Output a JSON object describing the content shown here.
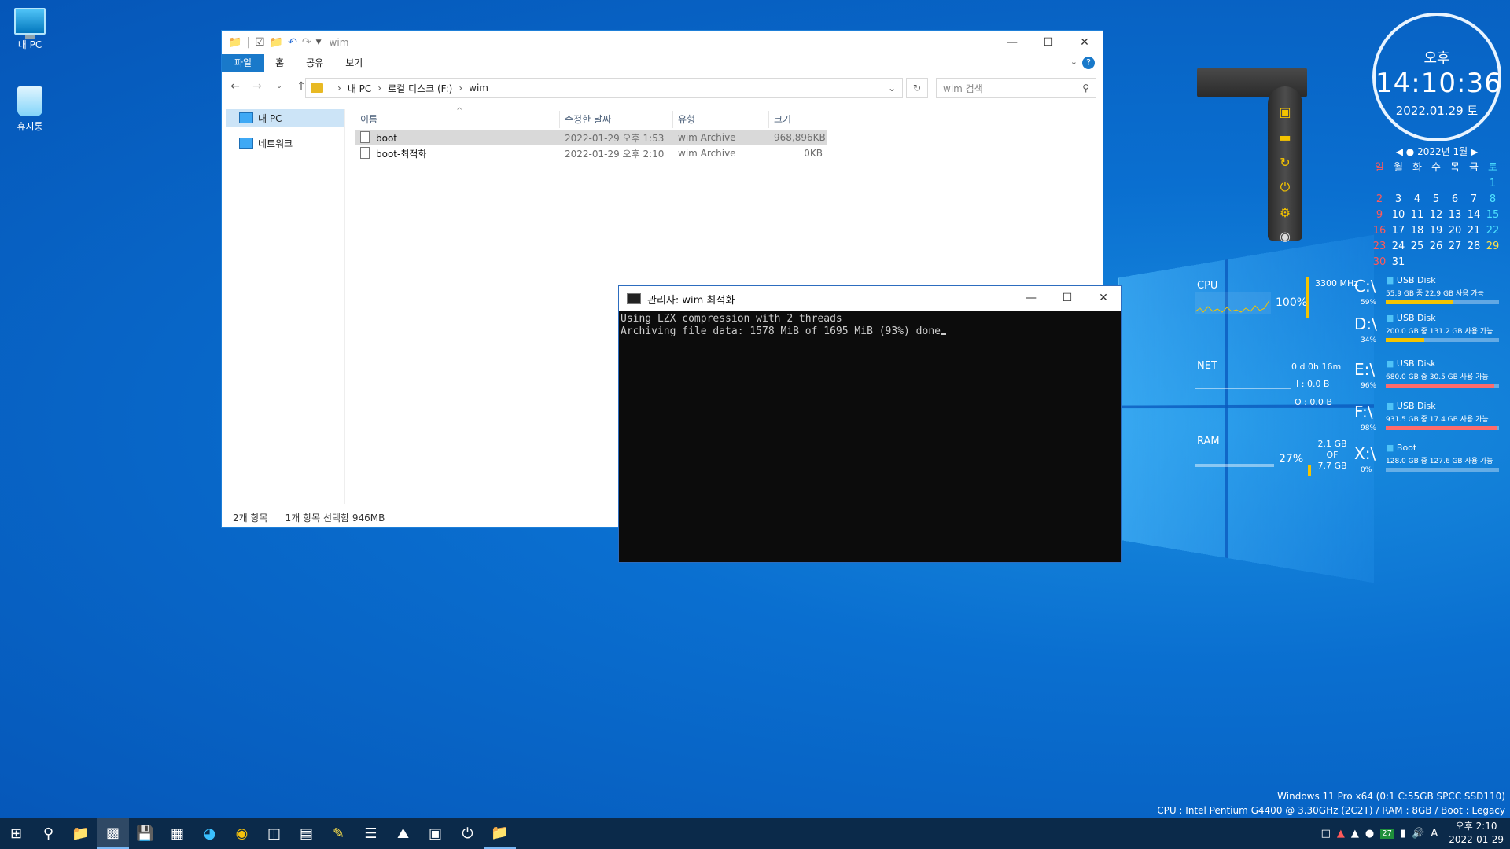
{
  "desktop": {
    "icons": [
      {
        "label": "내 PC"
      },
      {
        "label": "휴지통"
      }
    ]
  },
  "explorer": {
    "title": "wim",
    "ribbon_tabs": [
      "파일",
      "홈",
      "공유",
      "보기"
    ],
    "breadcrumb": [
      "내 PC",
      "로컬 디스크 (F:)",
      "wim"
    ],
    "search_placeholder": "wim 검색",
    "nav_items": [
      "내 PC",
      "네트워크"
    ],
    "columns": [
      "이름",
      "수정한 날짜",
      "유형",
      "크기"
    ],
    "files": [
      {
        "name": "boot",
        "modified": "2022-01-29 오후 1:53",
        "type": "wim Archive",
        "size": "968,896KB"
      },
      {
        "name": "boot-최적화",
        "modified": "2022-01-29 오후 2:10",
        "type": "wim Archive",
        "size": "0KB"
      }
    ],
    "status_count": "2개 항목",
    "status_selected": "1개 항목 선택함 946MB"
  },
  "console": {
    "title": "관리자:  wim 최적화",
    "lines": [
      "Using LZX compression with 2 threads",
      "Archiving file data: 1578 MiB of 1695 MiB (93%) done"
    ]
  },
  "clock": {
    "ampm": "오후",
    "time": "14:10:36",
    "date": "2022.01.29 토"
  },
  "calendar": {
    "header": "2022년 1월",
    "weekdays": [
      "일",
      "월",
      "화",
      "수",
      "목",
      "금",
      "토"
    ],
    "leading_blanks": 6,
    "days": 31,
    "today": 29
  },
  "meters": {
    "cpu": {
      "label": "CPU",
      "freq": "3300 MHz",
      "percent": "100%",
      "level": 100
    },
    "net": {
      "label": "NET",
      "uptime": "0 d 0h 16m",
      "in": "I : 0.0 B",
      "out": "O : 0.0 B"
    },
    "ram": {
      "label": "RAM",
      "percent": "27%",
      "used": "2.1 GB",
      "of": "OF",
      "total": "7.7 GB",
      "level": 27
    }
  },
  "drives": [
    {
      "letter": "C:\\",
      "pct": "59%",
      "name": "USB Disk",
      "info": "55.9 GB 중  22.9 GB 사용 가능",
      "level": 59,
      "color": "#f5c400"
    },
    {
      "letter": "D:\\",
      "pct": "34%",
      "name": "USB Disk",
      "info": "200.0 GB 중  131.2 GB 사용 가능",
      "level": 34,
      "color": "#f5c400"
    },
    {
      "letter": "E:\\",
      "pct": "96%",
      "name": "USB Disk",
      "info": "680.0 GB 중 30.5 GB 사용 가능",
      "level": 96,
      "color": "#ff6b6b"
    },
    {
      "letter": "F:\\",
      "pct": "98%",
      "name": "USB Disk",
      "info": "931.5 GB 중  17.4 GB 사용 가능",
      "level": 98,
      "color": "#ff6b6b"
    },
    {
      "letter": "X:\\",
      "pct": "0%",
      "name": "Boot",
      "info": "128.0 GB 중  127.6 GB 사용 가능",
      "level": 0,
      "color": "#f5c400"
    }
  ],
  "sysinfo": {
    "line1": "Windows 11 Pro x64 (0:1 C:55GB SPCC SSD110)",
    "line2": "CPU : Intel Pentium G4400 @ 3.30GHz (2C2T) / RAM : 8GB / Boot : Legacy"
  },
  "taskbar": {
    "badge": "27",
    "ime": "A",
    "time": "오후 2:10",
    "date": "2022-01-29"
  }
}
